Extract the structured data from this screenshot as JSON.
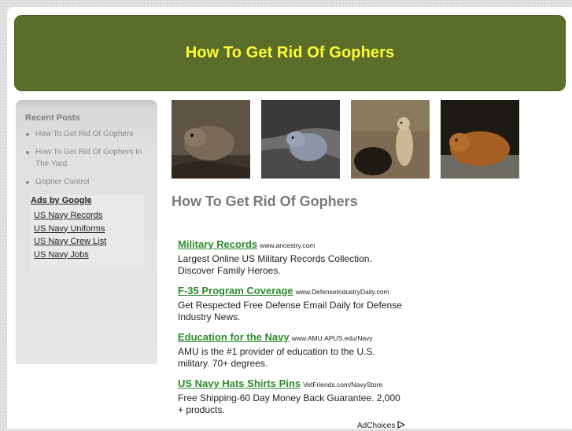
{
  "site": {
    "title": "How To Get Rid Of Gophers"
  },
  "sidebar": {
    "heading": "Recent Posts",
    "posts": [
      {
        "label": "How To Get Rid Of Gophers"
      },
      {
        "label": "How To Get Rid Of Gophers In The Yard"
      },
      {
        "label": "Gopher Control"
      }
    ],
    "ads": {
      "title": "Ads by Google",
      "links": [
        "US Navy Records",
        "US Navy Uniforms",
        "US Navy Crew List",
        "US Navy Jobs"
      ]
    }
  },
  "photos": [
    "gopher-photo-1",
    "gopher-photo-2",
    "gopher-photo-3",
    "gopher-photo-4"
  ],
  "main": {
    "heading": "How To Get Rid Of Gophers",
    "ads": [
      {
        "title": "Military Records",
        "url": "www.ancestry.com",
        "desc": "Largest Online US Military Records Collection. Discover Family Heroes."
      },
      {
        "title": "F-35 Program Coverage",
        "url": "www.DefenseIndustryDaily.com",
        "desc": "Get Respected Free Defense Email Daily for Defense Industry News."
      },
      {
        "title": "Education for the Navy",
        "url": "www.AMU.APUS.edu/Navy",
        "desc": "AMU is the #1 provider of education to the U.S. military. 70+ degrees."
      },
      {
        "title": "US Navy Hats Shirts Pins",
        "url": "VetFriends.com/NavyStore",
        "desc": "Free Shipping-60 Day Money Back Guarantee. 2,000 + products."
      }
    ],
    "adchoices": "AdChoices"
  },
  "colors": {
    "header_bg": "#5a6d2b",
    "title": "#ffff33",
    "ad_link": "#2e8b2e"
  }
}
